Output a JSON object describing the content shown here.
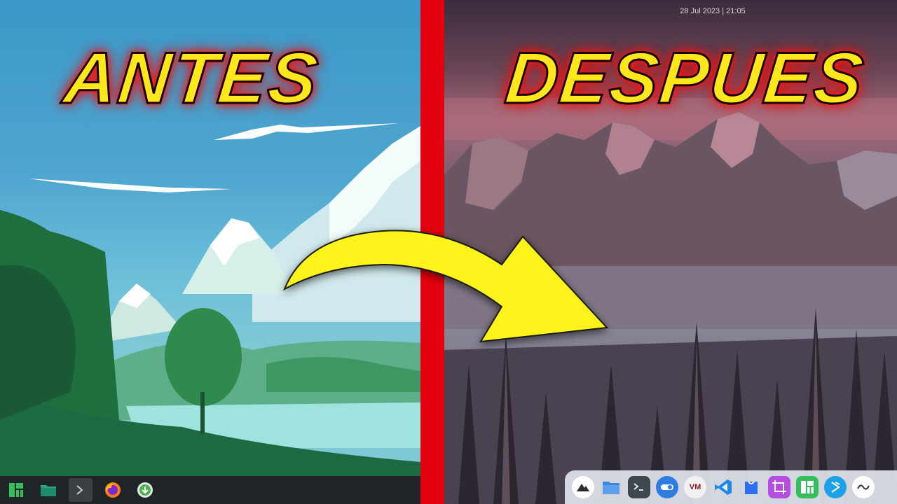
{
  "titles": {
    "before": "ANTES",
    "after": "DESPUES"
  },
  "colors": {
    "title_fill": "#ffe71c",
    "title_glow": "#ff1a1a",
    "divider": "#e3000f",
    "arrow": "#fff31c"
  },
  "before_desktop": {
    "taskbar_items": [
      {
        "name": "manjaro-menu-icon"
      },
      {
        "name": "file-manager-icon"
      },
      {
        "name": "terminal-icon"
      },
      {
        "name": "firefox-icon"
      },
      {
        "name": "download-icon"
      }
    ]
  },
  "after_desktop": {
    "datetime": "28 Jul 2023 | 21:05",
    "dock_items": [
      {
        "name": "launcher-icon"
      },
      {
        "name": "folder-icon"
      },
      {
        "name": "terminal-icon"
      },
      {
        "name": "toggle-icon"
      },
      {
        "name": "vm-icon",
        "label": "VM"
      },
      {
        "name": "vscode-icon"
      },
      {
        "name": "store-icon"
      },
      {
        "name": "screenshot-icon"
      },
      {
        "name": "manjaro-icon"
      },
      {
        "name": "kdeconnect-icon"
      },
      {
        "name": "flow-icon"
      }
    ]
  }
}
